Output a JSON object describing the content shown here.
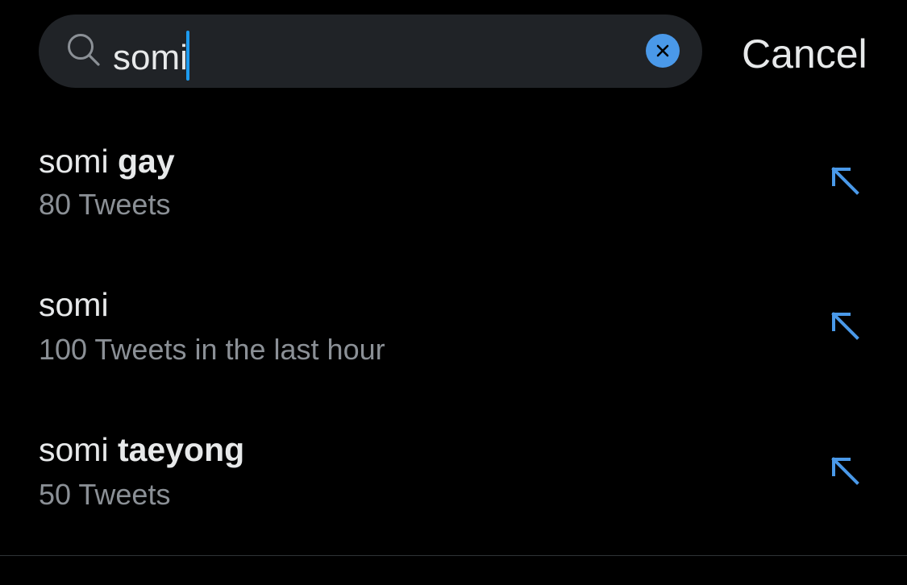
{
  "search": {
    "value": "somi",
    "icon": "search-icon",
    "clear_icon": "close-icon"
  },
  "cancel_label": "Cancel",
  "suggestions": [
    {
      "base": "somi ",
      "bold": "gay",
      "subtitle": "80 Tweets",
      "icon": "arrow-up-left-icon"
    },
    {
      "base": "somi",
      "bold": "",
      "subtitle": "100 Tweets in the last hour",
      "icon": "arrow-up-left-icon"
    },
    {
      "base": "somi ",
      "bold": "taeyong",
      "subtitle": "50 Tweets",
      "icon": "arrow-up-left-icon"
    }
  ],
  "colors": {
    "background": "#000000",
    "search_bg": "#202327",
    "accent": "#1d9bf0",
    "arrow": "#4a99e9",
    "primary_text": "#e7e9ea",
    "secondary_text": "#8b9096"
  }
}
